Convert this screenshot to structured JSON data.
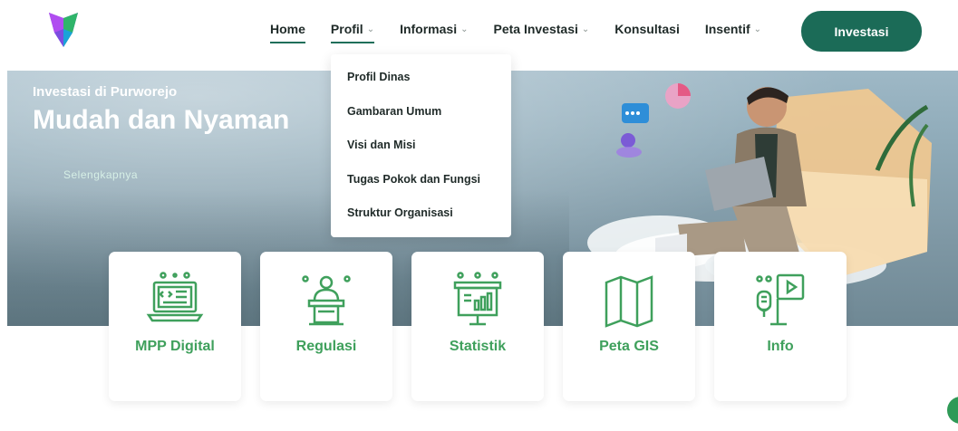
{
  "header": {
    "logo": "logo-icon",
    "nav": [
      {
        "label": "Home",
        "has_caret": false,
        "state": "active"
      },
      {
        "label": "Profil",
        "has_caret": true,
        "state": "open"
      },
      {
        "label": "Informasi",
        "has_caret": true,
        "state": ""
      },
      {
        "label": "Peta Investasi",
        "has_caret": true,
        "state": ""
      },
      {
        "label": "Konsultasi",
        "has_caret": false,
        "state": ""
      },
      {
        "label": "Insentif",
        "has_caret": true,
        "state": ""
      }
    ],
    "cta_label": "Investasi"
  },
  "dropdown": {
    "items": [
      "Profil Dinas",
      "Gambaran Umum",
      "Visi dan Misi",
      "Tugas Pokok dan Fungsi",
      "Struktur Organisasi"
    ]
  },
  "hero": {
    "kicker": "Investasi di Purworejo",
    "title": "Mudah dan Nyaman",
    "link": "Selengkapnya"
  },
  "cards": [
    {
      "label": "MPP Digital",
      "icon": "laptop-code-icon"
    },
    {
      "label": "Regulasi",
      "icon": "speaker-podium-icon"
    },
    {
      "label": "Statistik",
      "icon": "presentation-chart-icon"
    },
    {
      "label": "Peta GIS",
      "icon": "map-icon"
    },
    {
      "label": "Info",
      "icon": "info-media-icon"
    }
  ],
  "colors": {
    "brand": "#1b6b57",
    "accent_green": "#3fa05c"
  }
}
